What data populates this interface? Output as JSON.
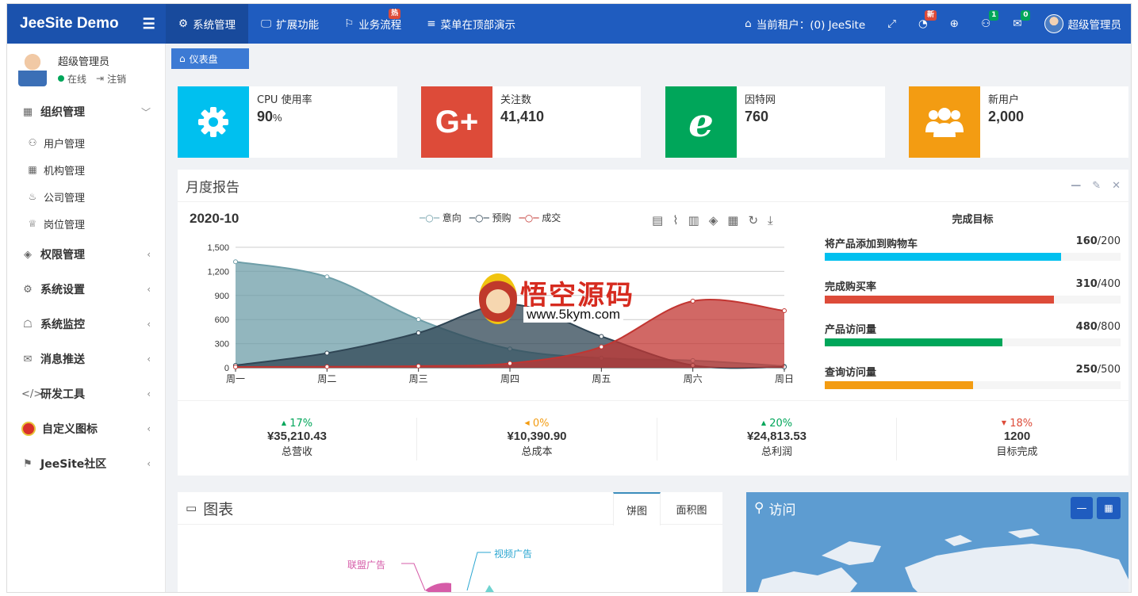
{
  "header": {
    "logo": "JeeSite Demo",
    "nav": [
      {
        "label": "系统管理",
        "icon": "gear-icon",
        "active": true
      },
      {
        "label": "扩展功能",
        "icon": "monitor-icon"
      },
      {
        "label": "业务流程",
        "icon": "flag-icon",
        "badge": "热"
      },
      {
        "label": "菜单在顶部演示",
        "icon": "list-icon"
      }
    ],
    "tenant": "当前租户：(0) JeeSite",
    "badge_new": "新",
    "badge_users": "1",
    "badge_mail": "0",
    "username": "超级管理员"
  },
  "sidebar": {
    "user_name": "超级管理员",
    "online": "在线",
    "logout": "注销",
    "menu": [
      {
        "label": "组织管理",
        "icon": "grid-icon",
        "arrow": "﹀"
      },
      {
        "label": "用户管理",
        "icon": "user-icon",
        "sub": true
      },
      {
        "label": "机构管理",
        "icon": "grid-icon",
        "sub": true
      },
      {
        "label": "公司管理",
        "icon": "fire-icon",
        "sub": true
      },
      {
        "label": "岗位管理",
        "icon": "trophy-icon",
        "sub": true
      },
      {
        "label": "权限管理",
        "icon": "layers-icon",
        "arrow": "‹"
      },
      {
        "label": "系统设置",
        "icon": "gear-icon",
        "arrow": "‹"
      },
      {
        "label": "系统监控",
        "icon": "ghost-icon",
        "arrow": "‹"
      },
      {
        "label": "消息推送",
        "icon": "inbox-icon",
        "arrow": "‹"
      },
      {
        "label": "研发工具",
        "icon": "code-icon",
        "arrow": "‹"
      },
      {
        "label": "自定义图标",
        "icon": "angry-bird-icon",
        "arrow": "‹"
      },
      {
        "label": "JeeSite社区",
        "icon": "signpost-icon",
        "arrow": "‹"
      }
    ]
  },
  "tab": {
    "label": "仪表盘",
    "icon": "home-icon"
  },
  "infoboxes": [
    {
      "label": "CPU 使用率",
      "value": "90",
      "unit": "%",
      "icon": "gear-icon",
      "color": "#00c0ef"
    },
    {
      "label": "关注数",
      "value": "41,410",
      "icon": "google-plus-icon",
      "color": "#dd4b39"
    },
    {
      "label": "因特网",
      "value": "760",
      "icon": "ie-icon",
      "color": "#00a65a"
    },
    {
      "label": "新用户",
      "value": "2,000",
      "icon": "users-icon",
      "color": "#f39c12"
    }
  ],
  "report": {
    "title": "月度报告",
    "chart_title": "2020-10",
    "goal_title": "完成目标",
    "goals": [
      {
        "label": "将产品添加到购物车",
        "value": "160",
        "total": "/200",
        "ratio": 0.8,
        "color": "#00c0ef"
      },
      {
        "label": "完成购买率",
        "value": "310",
        "total": "/400",
        "ratio": 0.775,
        "color": "#dd4b39"
      },
      {
        "label": "产品访问量",
        "value": "480",
        "total": "/800",
        "ratio": 0.6,
        "color": "#00a65a"
      },
      {
        "label": "查询访问量",
        "value": "250",
        "total": "/500",
        "ratio": 0.5,
        "color": "#f39c12"
      }
    ],
    "stats": [
      {
        "change": "17%",
        "dir": "up",
        "amount": "¥35,210.43",
        "label": "总营收",
        "color": "#00a65a"
      },
      {
        "change": "0%",
        "dir": "left",
        "amount": "¥10,390.90",
        "label": "总成本",
        "color": "#f39c12"
      },
      {
        "change": "20%",
        "dir": "up",
        "amount": "¥24,813.53",
        "label": "总利润",
        "color": "#00a65a"
      },
      {
        "change": "18%",
        "dir": "down",
        "amount": "1200",
        "label": "目标完成",
        "color": "#dd4b39"
      }
    ]
  },
  "chart_data": {
    "type": "area",
    "categories": [
      "周一",
      "周二",
      "周三",
      "周四",
      "周五",
      "周六",
      "周日"
    ],
    "ylim": [
      0,
      1500
    ],
    "yticks": [
      0,
      300,
      600,
      900,
      "1,200",
      "1,500"
    ],
    "series": [
      {
        "name": "意向",
        "values": [
          1320,
          1132,
          601,
          234,
          120,
          90,
          20
        ],
        "color": "#6e9ea8"
      },
      {
        "name": "预购",
        "values": [
          30,
          182,
          434,
          791,
          390,
          30,
          10
        ],
        "color": "#2f4554"
      },
      {
        "name": "成交",
        "values": [
          10,
          12,
          21,
          54,
          260,
          830,
          710
        ],
        "color": "#c23531"
      }
    ]
  },
  "charts_box": {
    "title": "图表",
    "tabs": [
      "饼图",
      "面积图"
    ],
    "labels": [
      "联盟广告",
      "视频广告"
    ]
  },
  "visit_box": {
    "title": "访问"
  },
  "watermark": {
    "brand": "悟空源码",
    "url": "www.5kym.com"
  }
}
